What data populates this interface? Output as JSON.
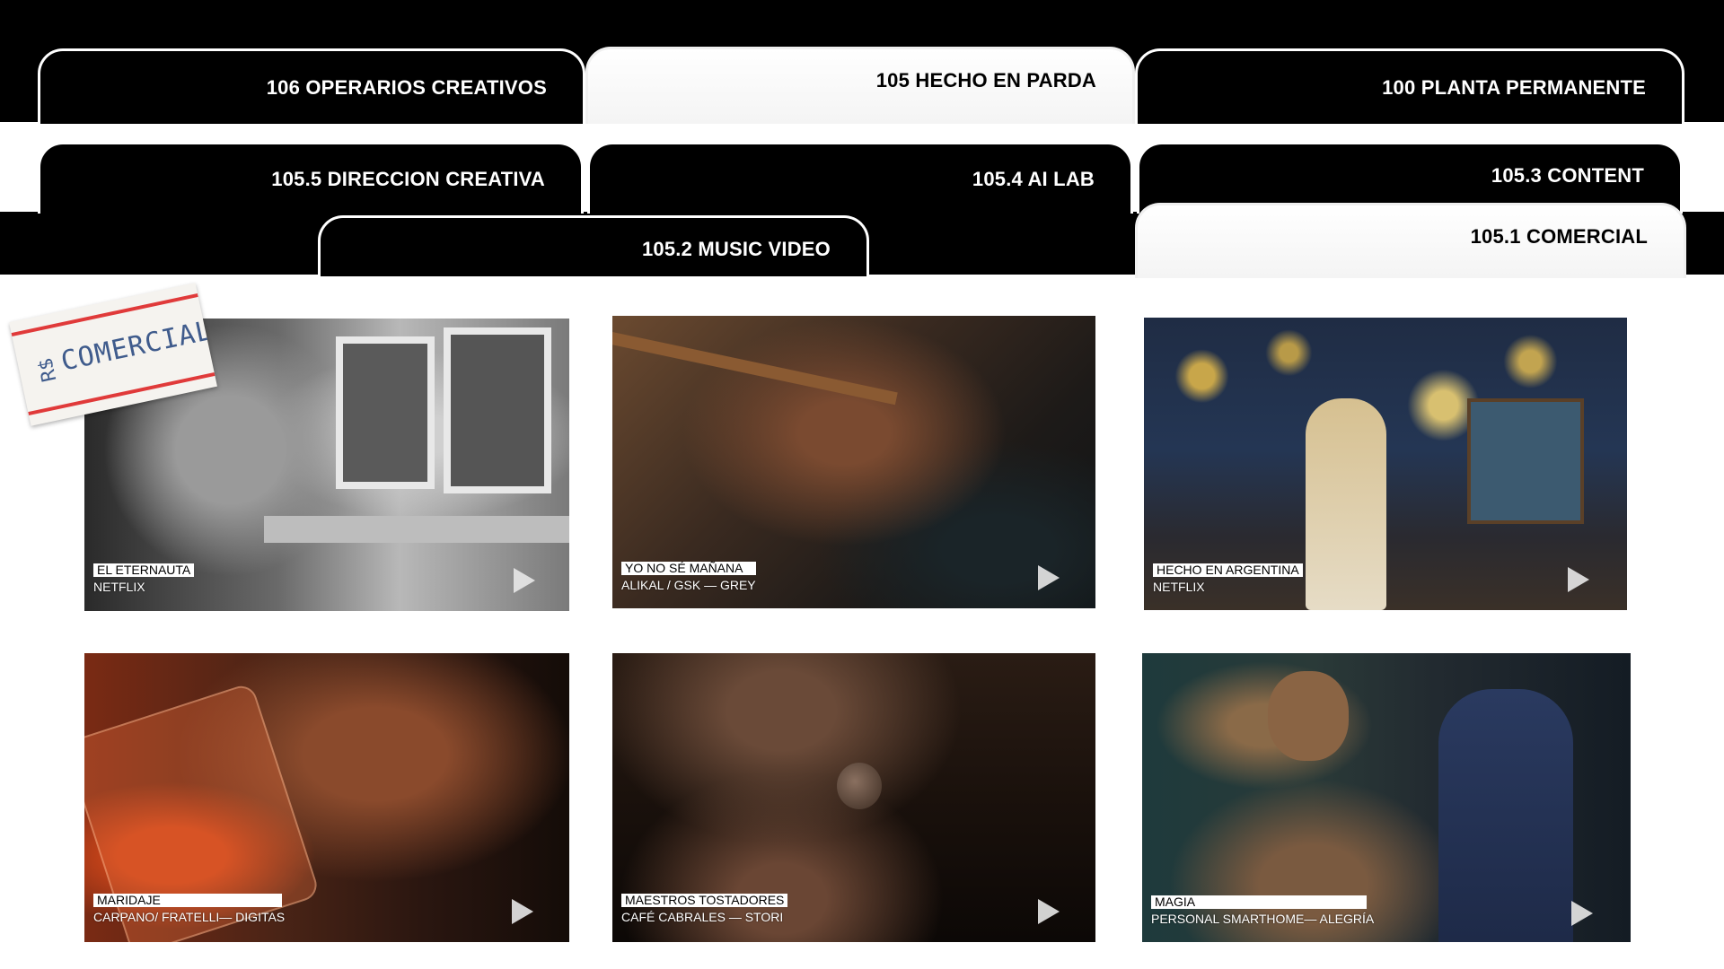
{
  "tabs": [
    {
      "label": "106 OPERARIOS CREATIVOS"
    },
    {
      "label": "105 HECHO EN PARDA"
    },
    {
      "label": "100 PLANTA PERMANENTE"
    },
    {
      "label": "105.5 DIRECCION CREATIVA"
    },
    {
      "label": "105.4 AI LAB"
    },
    {
      "label": "105.3 CONTENT"
    },
    {
      "label": "105.2 MUSIC VIDEO"
    },
    {
      "label": "105.1 COMERCIAL"
    }
  ],
  "sticker": {
    "text": "COMERCIAL"
  },
  "videos": [
    {
      "title": "EL ETERNAUTA",
      "subtitle": "NETFLIX"
    },
    {
      "title": "YO NO SÉ MAÑANA",
      "subtitle": "ALIKAL / GSK — GREY"
    },
    {
      "title": "HECHO EN ARGENTINA",
      "subtitle": "NETFLIX"
    },
    {
      "title": "MARIDAJE",
      "subtitle": "CARPANO/ FRATELLI— DIGITAS"
    },
    {
      "title": "MAESTROS TOSTADORES",
      "subtitle": "CAFÉ CABRALES — STORI"
    },
    {
      "title": "MAGIA",
      "subtitle": "PERSONAL SMARTHOME— ALEGRÍA"
    }
  ],
  "icons": {
    "play": "play-icon"
  },
  "colors": {
    "tab_bg": "#000000",
    "tab_active_bg": "#ffffff",
    "sticker_red": "#e03a3a",
    "sticker_ink": "#3f5b8c"
  }
}
